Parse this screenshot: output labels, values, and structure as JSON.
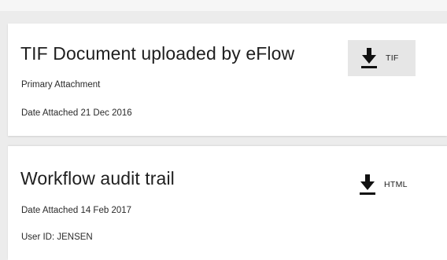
{
  "attachments": [
    {
      "title": "TIF Document uploaded by eFlow",
      "details": [
        "Primary Attachment",
        "Date Attached 21 Dec 2016"
      ],
      "download": {
        "icon": "download-icon",
        "format_label": "TIF",
        "highlighted": true
      }
    },
    {
      "title": "Workflow audit trail",
      "details": [
        "Date Attached 14 Feb 2017",
        "User ID: JENSEN"
      ],
      "download": {
        "icon": "download-icon",
        "format_label": "HTML",
        "highlighted": false
      }
    }
  ],
  "colors": {
    "page_background": "#ececec",
    "card_background": "#ffffff",
    "highlighted_button_background": "#e6e6e6",
    "text": "#222222"
  }
}
